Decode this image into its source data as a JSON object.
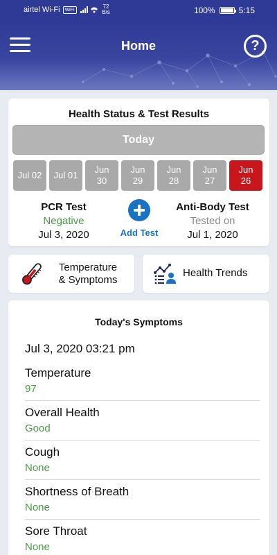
{
  "status_bar": {
    "carrier": "airtel Wi-Fi",
    "wifi_badge": "WiFi",
    "speed_value": "72",
    "speed_unit": "B/s",
    "battery": "100%",
    "time": "5:15"
  },
  "header": {
    "title": "Home",
    "help_glyph": "?",
    "menu_icon": "hamburger-menu-icon",
    "help_icon": "help-circle-icon"
  },
  "health_card": {
    "title": "Health Status & Test Results",
    "today_label": "Today",
    "dates": [
      {
        "line1": "Jul 02",
        "line2": ""
      },
      {
        "line1": "Jul 01",
        "line2": ""
      },
      {
        "line1": "Jun",
        "line2": "30"
      },
      {
        "line1": "Jun",
        "line2": "29"
      },
      {
        "line1": "Jun",
        "line2": "28"
      },
      {
        "line1": "Jun",
        "line2": "27"
      },
      {
        "line1": "Jun",
        "line2": "26"
      }
    ],
    "selected_date_index": 6,
    "pcr": {
      "name": "PCR Test",
      "result": "Negative",
      "date": "Jul 3, 2020"
    },
    "add_test_label": "Add Test",
    "antibody": {
      "name": "Anti-Body Test",
      "result": "Tested on",
      "date": "Jul 1, 2020"
    }
  },
  "actions": {
    "temperature": {
      "line1": "Temperature",
      "line2": "& Symptoms",
      "icon": "thermometer-icon"
    },
    "trends": {
      "label": "Health Trends",
      "icon": "health-trends-icon"
    }
  },
  "symptoms": {
    "title": "Today's Symptoms",
    "timestamp": "Jul 3, 2020 03:21 pm",
    "items": [
      {
        "name": "Temperature",
        "value": "97"
      },
      {
        "name": "Overall Health",
        "value": "Good"
      },
      {
        "name": "Cough",
        "value": "None"
      },
      {
        "name": "Shortness of Breath",
        "value": "None"
      },
      {
        "name": "Sore Throat",
        "value": "None"
      }
    ]
  },
  "colors": {
    "header": "#2f3a96",
    "accent_blue": "#1a72c4",
    "positive_green": "#4a9b44",
    "selected_red": "#c8161d",
    "chip_gray": "#a9a9a9"
  }
}
